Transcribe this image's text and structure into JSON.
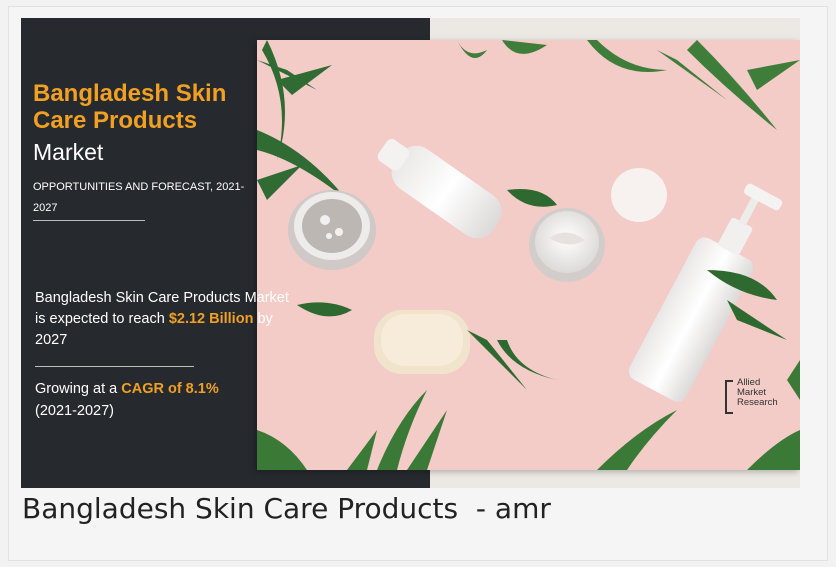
{
  "banner": {
    "title": "Bangladesh Skin Care Products",
    "market": "Market",
    "opportunities": "OPPORTUNITIES AND FORECAST, 2021-2027",
    "expected_prefix": "Bangladesh Skin Care Products Market is expected to reach ",
    "expected_value": "$2.12 Billion",
    "expected_suffix": " by 2027",
    "growing_prefix": "Growing at a ",
    "growing_value": "CAGR of 8.1%",
    "growing_period": "(2021-2027)",
    "logo_text": "Allied\nMarket\nResearch"
  },
  "caption": "Bangladesh Skin Care Products  - amr",
  "colors": {
    "accent": "#f0a023",
    "panel": "#26292e",
    "photo_background": "#f2c9c5"
  }
}
